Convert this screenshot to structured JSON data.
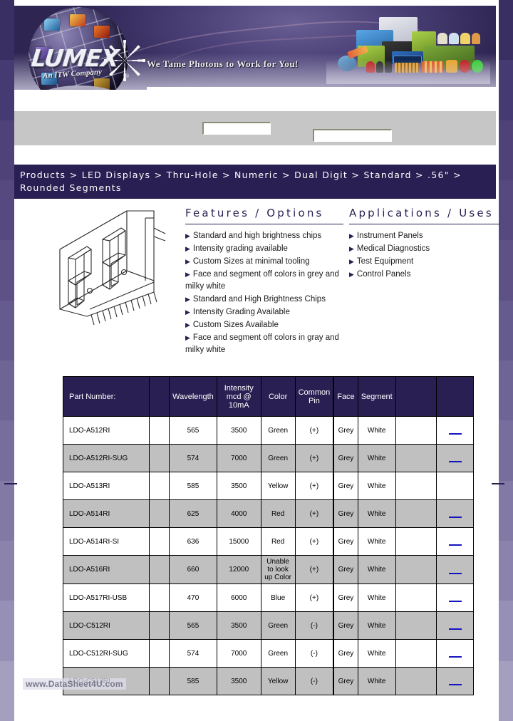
{
  "header": {
    "brand_name": "LUMEX",
    "brand_tagline": "An ITW Company",
    "brand_reg": "®",
    "slogan": "We Tame Photons to Work for You!",
    "logo_icon": "lumex-globe-logo",
    "collage_icon": "led-products-photo"
  },
  "search": {
    "field_a_value": "",
    "field_b_value": "",
    "field_a_placeholder": "",
    "field_b_placeholder": ""
  },
  "breadcrumb": {
    "text": "Products > LED Displays > Thru-Hole > Numeric > Dual Digit > Standard > .56\" > Rounded Segments",
    "items": [
      "Products",
      "LED Displays",
      "Thru-Hole",
      "Numeric",
      "Dual Digit",
      "Standard",
      ".56\"",
      "Rounded Segments"
    ],
    "separator": ">"
  },
  "product_drawing": {
    "icon": "dual-digit-seven-segment-display-drawing",
    "alt": "Dual digit rounded segment LED display line drawing"
  },
  "features": {
    "title": "Features / Options",
    "bullet_glyph": "▶",
    "items": [
      "Standard and high brightness chips",
      "Intensity grading available",
      "Custom Sizes at minimal tooling",
      "Face and segment off colors in grey and milky white",
      "Standard and High Brightness Chips",
      "Intensity Grading Available",
      "Custom Sizes Available",
      "Face and segment off colors in gray and milky white"
    ]
  },
  "applications": {
    "title": "Applications / Uses",
    "bullet_glyph": "▶",
    "items": [
      "Instrument Panels",
      "Medical Diagnostics",
      "Test Equipment",
      "Control Panels"
    ]
  },
  "table": {
    "columns": [
      "Part Number:",
      "",
      "Wavelength",
      "Intensity mcd @ 10mA",
      "Color",
      "Common Pin",
      "Face",
      "Segment",
      "",
      ""
    ],
    "intensity_header_lines": [
      "Intensity",
      "mcd @",
      "10mA"
    ],
    "common_pin_header_lines": [
      "Common",
      "Pin"
    ],
    "link_glyph": "—",
    "rows": [
      {
        "part": "LDO-A512RI",
        "blank1": "",
        "wavelength": "565",
        "intensity": "3500",
        "color": "Green",
        "pin": "(+)",
        "face": "Grey",
        "segment": "White",
        "blank2": "",
        "link": "—"
      },
      {
        "part": "LDO-A512RI-SUG",
        "blank1": "",
        "wavelength": "574",
        "intensity": "7000",
        "color": "Green",
        "pin": "(+)",
        "face": "Grey",
        "segment": "White",
        "blank2": "",
        "link": "—"
      },
      {
        "part": "LDO-A513RI",
        "blank1": "",
        "wavelength": "585",
        "intensity": "3500",
        "color": "Yellow",
        "pin": "(+)",
        "face": "Grey",
        "segment": "White",
        "blank2": "",
        "link": ""
      },
      {
        "part": "LDO-A514RI",
        "blank1": "",
        "wavelength": "625",
        "intensity": "4000",
        "color": "Red",
        "pin": "(+)",
        "face": "Grey",
        "segment": "White",
        "blank2": "",
        "link": "—"
      },
      {
        "part": "LDO-A514RI-SI",
        "blank1": "",
        "wavelength": "636",
        "intensity": "15000",
        "color": "Red",
        "pin": "(+)",
        "face": "Grey",
        "segment": "White",
        "blank2": "",
        "link": "—"
      },
      {
        "part": "LDO-A516RI",
        "blank1": "",
        "wavelength": "660",
        "intensity": "12000",
        "color": "Unable to look up Color",
        "pin": "(+)",
        "face": "Grey",
        "segment": "White",
        "blank2": "",
        "link": "—"
      },
      {
        "part": "LDO-A517RI-USB",
        "blank1": "",
        "wavelength": "470",
        "intensity": "6000",
        "color": "Blue",
        "pin": "(+)",
        "face": "Grey",
        "segment": "White",
        "blank2": "",
        "link": "—"
      },
      {
        "part": "LDO-C512RI",
        "blank1": "",
        "wavelength": "565",
        "intensity": "3500",
        "color": "Green",
        "pin": "(-)",
        "face": "Grey",
        "segment": "White",
        "blank2": "",
        "link": "—"
      },
      {
        "part": "LDO-C512RI-SUG",
        "blank1": "",
        "wavelength": "574",
        "intensity": "7000",
        "color": "Green",
        "pin": "(-)",
        "face": "Grey",
        "segment": "White",
        "blank2": "",
        "link": "—"
      },
      {
        "part": "LDO-C513RI",
        "blank1": "",
        "wavelength": "585",
        "intensity": "3500",
        "color": "Yellow",
        "pin": "(-)",
        "face": "Grey",
        "segment": "White",
        "blank2": "",
        "link": "—"
      }
    ]
  },
  "watermark": {
    "text": "www.DataSheet4U.com"
  },
  "colors": {
    "header_purple": "#2a1f52",
    "table_header_bg": "#2a1f52",
    "alt_row_bg": "#c0c0c0",
    "link_blue": "#1515c0",
    "grey_bar": "#c6c6c6"
  }
}
